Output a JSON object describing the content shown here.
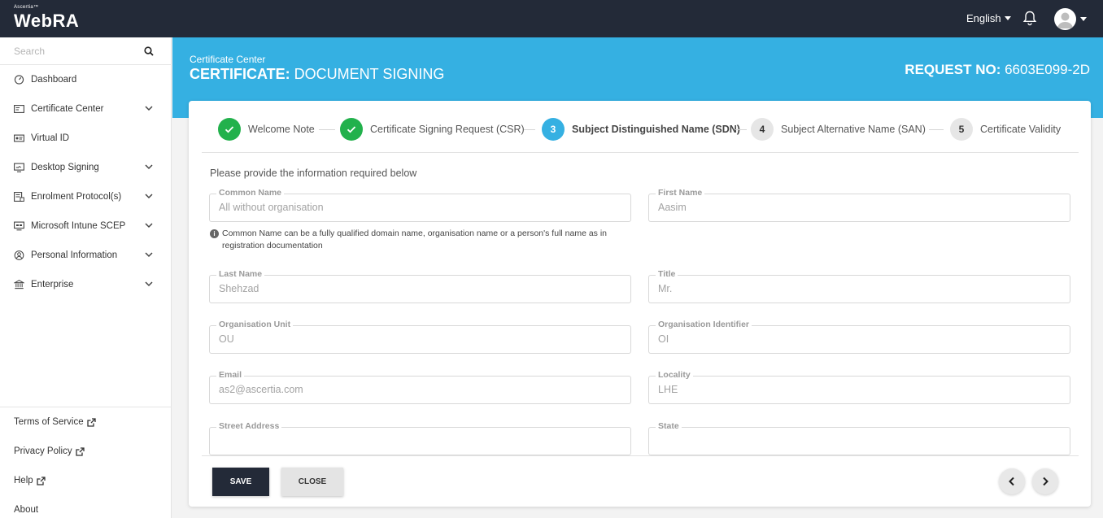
{
  "topbar": {
    "brand_small": "Ascertia™",
    "brand": "WebRA",
    "language": "English",
    "bell_icon": "bell-icon",
    "avatar_icon": "user-avatar"
  },
  "sidebar": {
    "search_placeholder": "Search",
    "items": [
      {
        "label": "Dashboard",
        "icon": "dashboard-icon",
        "expandable": false
      },
      {
        "label": "Certificate Center",
        "icon": "certificate-icon",
        "expandable": true
      },
      {
        "label": "Virtual ID",
        "icon": "id-card-icon",
        "expandable": false
      },
      {
        "label": "Desktop Signing",
        "icon": "desktop-signing-icon",
        "expandable": true
      },
      {
        "label": "Enrolment Protocol(s)",
        "icon": "enrolment-icon",
        "expandable": true
      },
      {
        "label": "Microsoft Intune SCEP",
        "icon": "intune-icon",
        "expandable": true
      },
      {
        "label": "Personal Information",
        "icon": "person-icon",
        "expandable": true
      },
      {
        "label": "Enterprise",
        "icon": "bank-icon",
        "expandable": true
      }
    ],
    "bottom_links": [
      {
        "label": "Terms of Service",
        "external": true
      },
      {
        "label": "Privacy Policy",
        "external": true
      },
      {
        "label": "Help",
        "external": true
      },
      {
        "label": "About",
        "external": false
      }
    ]
  },
  "header": {
    "breadcrumb": "Certificate Center",
    "title_bold": "CERTIFICATE:",
    "title_rest": " DOCUMENT SIGNING",
    "request_label": "REQUEST NO:",
    "request_value": " 6603E099-2D"
  },
  "stepper": {
    "steps": [
      {
        "label": "Welcome Note",
        "state": "done",
        "number": ""
      },
      {
        "label": "Certificate Signing Request (CSR)",
        "state": "done",
        "number": ""
      },
      {
        "label": "Subject Distinguished Name (SDN)",
        "state": "active",
        "number": "3"
      },
      {
        "label": "Subject Alternative Name (SAN)",
        "state": "todo",
        "number": "4"
      },
      {
        "label": "Certificate Validity",
        "state": "todo",
        "number": "5"
      }
    ]
  },
  "form": {
    "intro": "Please provide the information required below",
    "hint": "Common Name can be a fully qualified domain name, organisation name or a person's full name as in registration documentation",
    "fields": {
      "common_name": {
        "label": "Common Name",
        "value": "All without organisation"
      },
      "first_name": {
        "label": "First Name",
        "value": "Aasim"
      },
      "last_name": {
        "label": "Last Name",
        "value": "Shehzad"
      },
      "title": {
        "label": "Title",
        "value": "Mr."
      },
      "org_unit": {
        "label": "Organisation Unit",
        "value": "OU"
      },
      "org_identifier": {
        "label": "Organisation Identifier",
        "value": "OI"
      },
      "email": {
        "label": "Email",
        "value": "as2@ascertia.com"
      },
      "locality": {
        "label": "Locality",
        "value": "LHE"
      },
      "street": {
        "label": "Street Address",
        "value": ""
      },
      "state": {
        "label": "State",
        "value": ""
      }
    }
  },
  "footer": {
    "save_label": "SAVE",
    "close_label": "CLOSE"
  },
  "colors": {
    "topbar": "#232a38",
    "accent": "#35b0e2",
    "success": "#22b14c"
  }
}
